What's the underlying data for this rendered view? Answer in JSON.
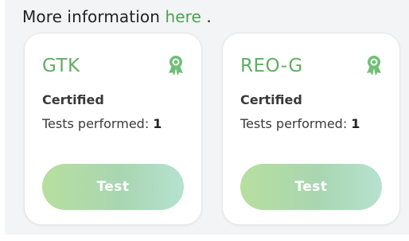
{
  "info": {
    "prefix": "More information ",
    "link_text": "here",
    "suffix": " ."
  },
  "cards": [
    {
      "name": "GTK",
      "status": "Certified",
      "tests_label": "Tests performed: ",
      "tests_count": "1",
      "button_label": "Test",
      "icon": "award-icon"
    },
    {
      "name": "REO-G",
      "status": "Certified",
      "tests_label": "Tests performed: ",
      "tests_count": "1",
      "button_label": "Test",
      "icon": "award-icon"
    }
  ],
  "colors": {
    "accent": "#5fae63",
    "link": "#4aa24f",
    "button_start": "#b7df9f",
    "button_end": "#b6e2cf"
  }
}
